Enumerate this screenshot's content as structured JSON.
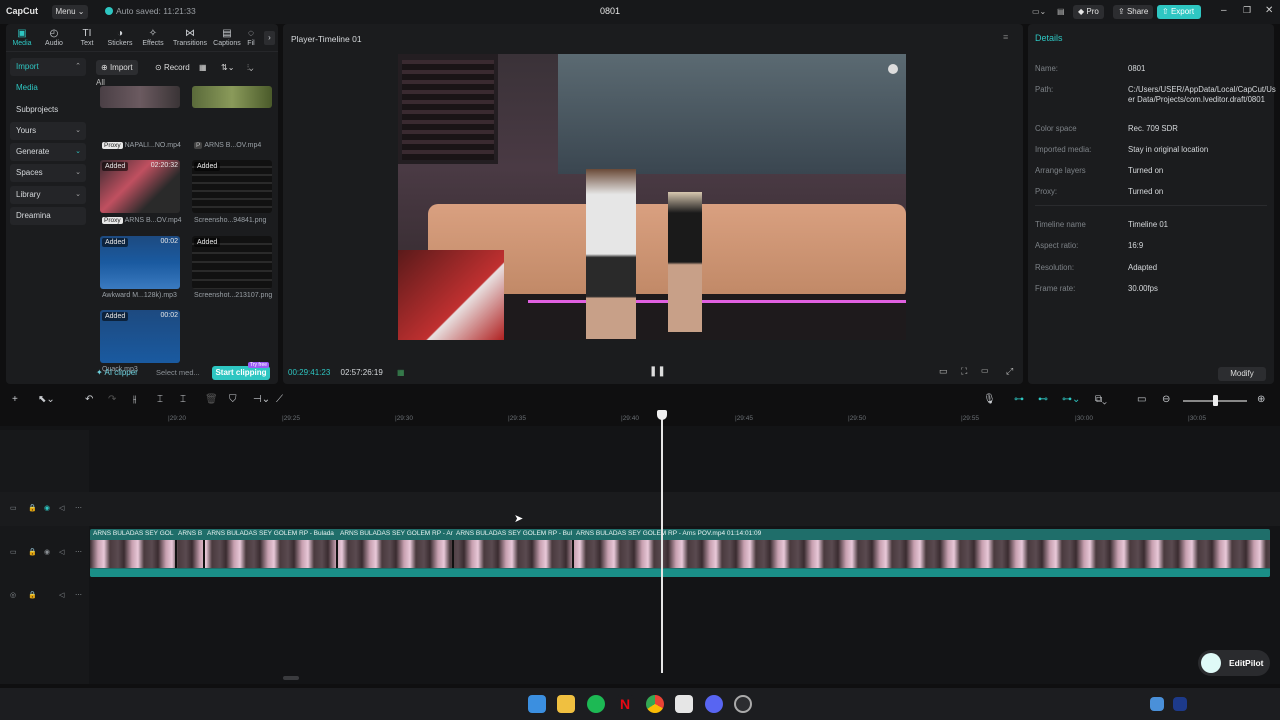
{
  "app": {
    "logo": "CapCut",
    "menu_label": "Menu",
    "autosave": "Auto saved: 11:21:33",
    "project_name": "0801"
  },
  "header_actions": {
    "pro": "Pro",
    "share": "Share",
    "export": "Export"
  },
  "toolbar_tabs": [
    {
      "label": "Media",
      "icon": "media-icon"
    },
    {
      "label": "Audio",
      "icon": "audio-icon"
    },
    {
      "label": "Text",
      "icon": "text-icon"
    },
    {
      "label": "Stickers",
      "icon": "stickers-icon"
    },
    {
      "label": "Effects",
      "icon": "effects-icon"
    },
    {
      "label": "Transitions",
      "icon": "transitions-icon"
    },
    {
      "label": "Captions",
      "icon": "captions-icon"
    },
    {
      "label": "Fil",
      "icon": "filters-icon"
    }
  ],
  "sidenav": [
    {
      "label": "Import"
    },
    {
      "label": "Media"
    },
    {
      "label": "Subprojects"
    },
    {
      "label": "Yours"
    },
    {
      "label": "Generate"
    },
    {
      "label": "Spaces"
    },
    {
      "label": "Library"
    },
    {
      "label": "Dreamina"
    }
  ],
  "media_toolbar": {
    "import": "Import",
    "record": "Record",
    "filter_all": "All"
  },
  "media_items": [
    {
      "name": "NAPALI...NO.mp4",
      "proxy": "Proxy",
      "added": "",
      "duration": ""
    },
    {
      "name": "ARNS B...OV.mp4",
      "proxy": "",
      "added": "",
      "duration": ""
    },
    {
      "name": "ARNS B...OV.mp4",
      "proxy": "Proxy",
      "added": "Added",
      "duration": "02:20:32"
    },
    {
      "name": "Screensho...94841.png",
      "proxy": "",
      "added": "Added",
      "duration": ""
    },
    {
      "name": "Awkward M...128k).mp3",
      "proxy": "",
      "added": "Added",
      "duration": "00:02"
    },
    {
      "name": "Screenshot...213107.png",
      "proxy": "",
      "added": "Added",
      "duration": ""
    },
    {
      "name": "Quack.mp3",
      "proxy": "",
      "added": "Added",
      "duration": "00:02"
    }
  ],
  "clipper": {
    "ai_clipper": "AI clipper",
    "select_media": "Select med...",
    "start_clipping": "Start clipping",
    "badge": "Try free"
  },
  "player": {
    "title": "Player-Timeline 01",
    "current_time": "00:29:41:23",
    "total_time": "02:57:26:19"
  },
  "details": {
    "title": "Details",
    "rows": [
      {
        "key": "Name:",
        "value": "0801"
      },
      {
        "key": "Path:",
        "value": "C:/Users/USER/AppData/Local/CapCut/User Data/Projects/com.lveditor.draft/0801"
      },
      {
        "key": "Color space",
        "value": "Rec. 709 SDR"
      },
      {
        "key": "Imported media:",
        "value": "Stay in original location"
      },
      {
        "key": "Arrange layers",
        "value": "Turned on"
      },
      {
        "key": "Proxy:",
        "value": "Turned on"
      },
      {
        "key": "Timeline name",
        "value": "Timeline 01"
      },
      {
        "key": "Aspect ratio:",
        "value": "16:9"
      },
      {
        "key": "Resolution:",
        "value": "Adapted"
      },
      {
        "key": "Frame rate:",
        "value": "30.00fps"
      }
    ],
    "modify": "Modify"
  },
  "ruler": [
    "|29:20",
    "|29:25",
    "|29:30",
    "|29:35",
    "|29:40",
    "|29:45",
    "|29:50",
    "|29:55",
    "|30:00",
    "|30:05"
  ],
  "clips": [
    {
      "label": "ARNS BULADAS SEY GOL"
    },
    {
      "label": "ARNS B"
    },
    {
      "label": "ARNS BULADAS SEY GOLEM RP - Bulada"
    },
    {
      "label": "ARNS BULADAS SEY GOLEM RP - Ar"
    },
    {
      "label": "ARNS BULADAS SEY GOLEM RP - Bul"
    },
    {
      "label": "ARNS BULADAS SEY GOLEM RP - Arns POV.mp4   01:14:01:09"
    }
  ],
  "editpilot": "EditPilot",
  "colors": {
    "accent": "#2ec6c2",
    "panel": "#1b1c1e",
    "clip": "#1f6e6a"
  }
}
